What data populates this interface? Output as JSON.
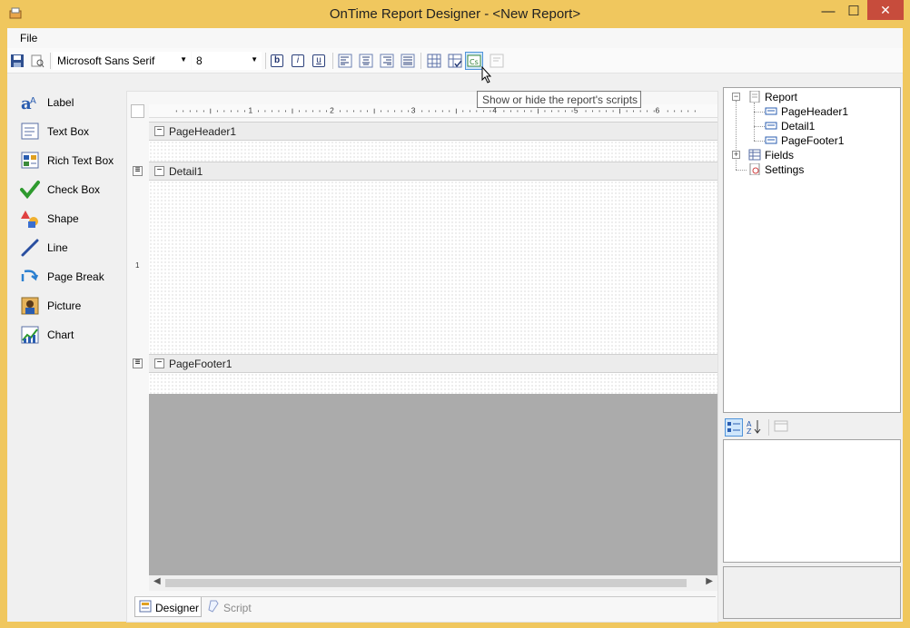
{
  "window": {
    "title": "OnTime Report Designer - <New Report>",
    "minimize_glyph": "—",
    "maximize_glyph": "☐",
    "close_glyph": "✕"
  },
  "menu": {
    "file_label": "File"
  },
  "toolbar": {
    "font_family": "Microsoft Sans Serif",
    "font_size": "8",
    "bold_label": "b",
    "italic_label": "i",
    "underline_label": "u"
  },
  "tooltip": {
    "text": "Show or hide the report's scripts"
  },
  "toolbox": {
    "items": [
      {
        "label": "Label",
        "icon": "label-icon"
      },
      {
        "label": "Text Box",
        "icon": "textbox-icon"
      },
      {
        "label": "Rich Text Box",
        "icon": "richtextbox-icon"
      },
      {
        "label": "Check Box",
        "icon": "checkbox-icon"
      },
      {
        "label": "Shape",
        "icon": "shape-icon"
      },
      {
        "label": "Line",
        "icon": "line-icon"
      },
      {
        "label": "Page Break",
        "icon": "pagebreak-icon"
      },
      {
        "label": "Picture",
        "icon": "picture-icon"
      },
      {
        "label": "Chart",
        "icon": "chart-icon"
      }
    ]
  },
  "ruler": {
    "marks": [
      "1",
      "2",
      "3",
      "4",
      "5",
      "6"
    ],
    "vertical_mark": "1"
  },
  "bands": {
    "page_header": "PageHeader1",
    "detail": "Detail1",
    "page_footer": "PageFooter1"
  },
  "tabs": {
    "designer": "Designer",
    "script": "Script"
  },
  "tree": {
    "root": "Report",
    "children": [
      "PageHeader1",
      "Detail1",
      "PageFooter1"
    ],
    "fields": "Fields",
    "settings": "Settings"
  },
  "colors": {
    "frame": "#f0c75e",
    "close_button": "#c74c3c",
    "selected_toggle": "#cfe6fb"
  }
}
